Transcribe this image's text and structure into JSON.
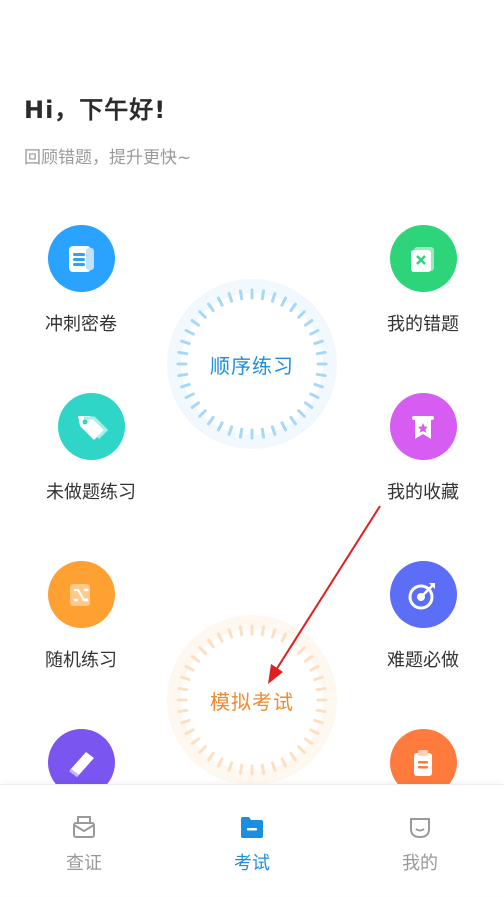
{
  "header": {
    "greeting": "Hi，下午好!",
    "subtitle": "回顾错题，提升更快~"
  },
  "features": {
    "sprint": {
      "label": "冲刺密卷",
      "icon": "document-icon",
      "color": "#29a3ff"
    },
    "wrong": {
      "label": "我的错题",
      "icon": "wrong-card-icon",
      "color": "#2ed47a"
    },
    "undone": {
      "label": "未做题练习",
      "icon": "tag-icon",
      "color": "#2fd6c8"
    },
    "favorites": {
      "label": "我的收藏",
      "icon": "bookmark-star-icon",
      "color": "#d65cf2"
    },
    "random": {
      "label": "随机练习",
      "icon": "shuffle-icon",
      "color": "#ffa033"
    },
    "hard": {
      "label": "难题必做",
      "icon": "target-arrow-icon",
      "color": "#5b6ef5"
    },
    "eraser": {
      "icon": "eraser-icon",
      "color": "#7a55f0"
    },
    "clipboard": {
      "icon": "clipboard-icon",
      "color": "#ff7a3d"
    }
  },
  "rings": {
    "sequence": {
      "label": "顺序练习",
      "color": "#1a8fe0",
      "tick_color": "#a8d8f8"
    },
    "mock": {
      "label": "模拟考试",
      "color": "#f08a2c",
      "tick_color": "#fce0c4"
    }
  },
  "tabs": [
    {
      "label": "查证",
      "icon": "certificate-icon",
      "active": false
    },
    {
      "label": "考试",
      "icon": "folder-icon",
      "active": true
    },
    {
      "label": "我的",
      "icon": "smile-icon",
      "active": false
    }
  ],
  "colors": {
    "active_tab": "#1a8fe0",
    "inactive_tab": "#999999",
    "annotation_arrow": "#e02020"
  }
}
